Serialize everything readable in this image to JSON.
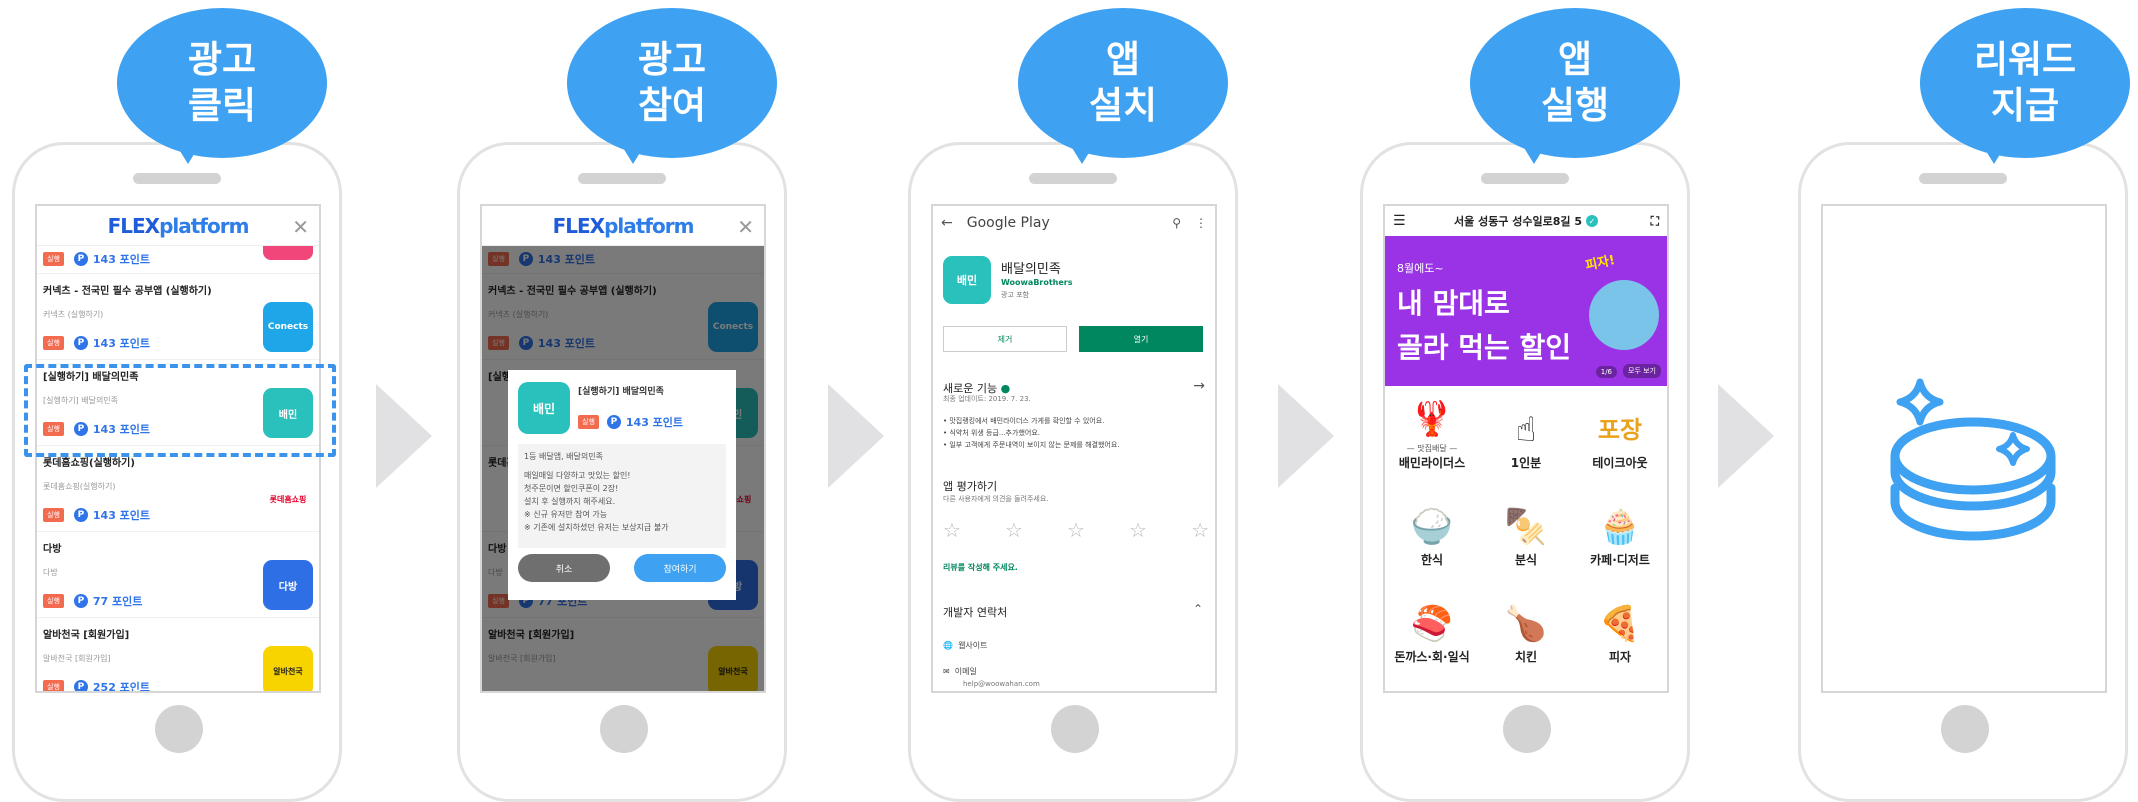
{
  "steps": [
    {
      "line1": "광고",
      "line2": "클릭"
    },
    {
      "line1": "광고",
      "line2": "참여"
    },
    {
      "line1": "앱",
      "line2": "설치"
    },
    {
      "line1": "앱",
      "line2": "실행"
    },
    {
      "line1": "리워드",
      "line2": "지급"
    }
  ],
  "colors": {
    "accent": "#3ea1f1",
    "chevron": "#e1e1e4",
    "baemin": "#9a33e6",
    "gp_green": "#01875f"
  },
  "flex": {
    "logo_a": "FLEX",
    "logo_b": "platform",
    "close": "✕",
    "rows": [
      {
        "title": "",
        "sub": "",
        "tag": "실행",
        "points": "143 포인트",
        "icon": "tag-icon"
      },
      {
        "title": "커넥츠 - 전국민 필수 공부앱 (실행하기)",
        "sub": "커넥츠 (실행하기)",
        "tag": "실행",
        "points": "143 포인트",
        "icon": "Conects",
        "color": "#1fa6e8"
      },
      {
        "title": "[실행하기] 배달의민족",
        "sub": "[실행하기] 배달의민족",
        "tag": "실행",
        "points": "143 포인트",
        "icon": "배민",
        "color": "#2ac1bc"
      },
      {
        "title": "롯데홈쇼핑(실행하기)",
        "sub": "롯데홈쇼핑(실행하기)",
        "tag": "실행",
        "points": "143 포인트",
        "icon": "롯데홈쇼핑",
        "color": "#e4002b"
      },
      {
        "title": "다방",
        "sub": "다방",
        "tag": "실행",
        "points": "77 포인트",
        "icon": "다방",
        "color": "#2f6fe6"
      },
      {
        "title": "알바천국 [회원가입]",
        "sub": "알바천국 [회원가입]",
        "tag": "실행",
        "points": "252 포인트",
        "icon": "알바천국",
        "color": "#f7d300"
      }
    ]
  },
  "modal": {
    "title": "[실행하기] 배달의민족",
    "tag": "실행",
    "points": "143 포인트",
    "body": [
      "1등 배달앱, 배달의민족",
      "매일매일 다양하고 맛있는 할인!",
      "첫주문이면 할인쿠폰이 2장!",
      "설치 후 실행까지 해주세요.",
      "※ 신규 유저만 참여 가능",
      "※ 기존에 설치하셨던 유저는 보상지급 불가"
    ],
    "cancel": "취소",
    "join": "참여하기"
  },
  "gplay": {
    "back": "←",
    "title": "Google Play",
    "app_name": "배달의민족",
    "dev": "WoowaBrothers",
    "meta": "광고 포함",
    "uninstall": "제거",
    "open": "열기",
    "whats_new": "새로운 기능",
    "updated": "최종 업데이트: 2019. 7. 23.",
    "notes": [
      "• 맛집랭킹에서 배민라이더스 가게를 확인할 수 있어요.",
      "• 식약처 위생 등급...추가했어요.",
      "• 일부 고객에게 주문내역이 보이지 않는 문제를 해결했어요."
    ],
    "rate": "앱 평가하기",
    "rate_sub": "다른 사용자에게 의견을 들려주세요.",
    "write_review": "리뷰를 작성해 주세요.",
    "dev_contact": "개발자 연락처",
    "website": "웹사이트",
    "email": "이메일",
    "email_addr": "help@woowahan.com"
  },
  "baemin": {
    "address": "서울 성동구 성수일로8길 5",
    "banner_small": "8월에도~",
    "banner_line1": "내 맘대로",
    "banner_line2": "골라 먹는 할인",
    "banner_tag": "피자!",
    "page": "1/6",
    "see_all": "모두 보기",
    "cells": [
      {
        "label": "배민라이더스",
        "top": "— 맛집배달 —",
        "icon": "🦞"
      },
      {
        "label": "1인분",
        "top": "",
        "icon": "☝"
      },
      {
        "label": "테이크아웃",
        "top": "",
        "icon": "포장"
      },
      {
        "label": "한식",
        "top": "",
        "icon": "🍚"
      },
      {
        "label": "분식",
        "top": "",
        "icon": "🍢"
      },
      {
        "label": "카페·디저트",
        "top": "",
        "icon": "🧁"
      },
      {
        "label": "돈까스·회·일식",
        "top": "",
        "icon": "🍣"
      },
      {
        "label": "치킨",
        "top": "",
        "icon": "🍗"
      },
      {
        "label": "피자",
        "top": "",
        "icon": "🍕"
      }
    ]
  }
}
